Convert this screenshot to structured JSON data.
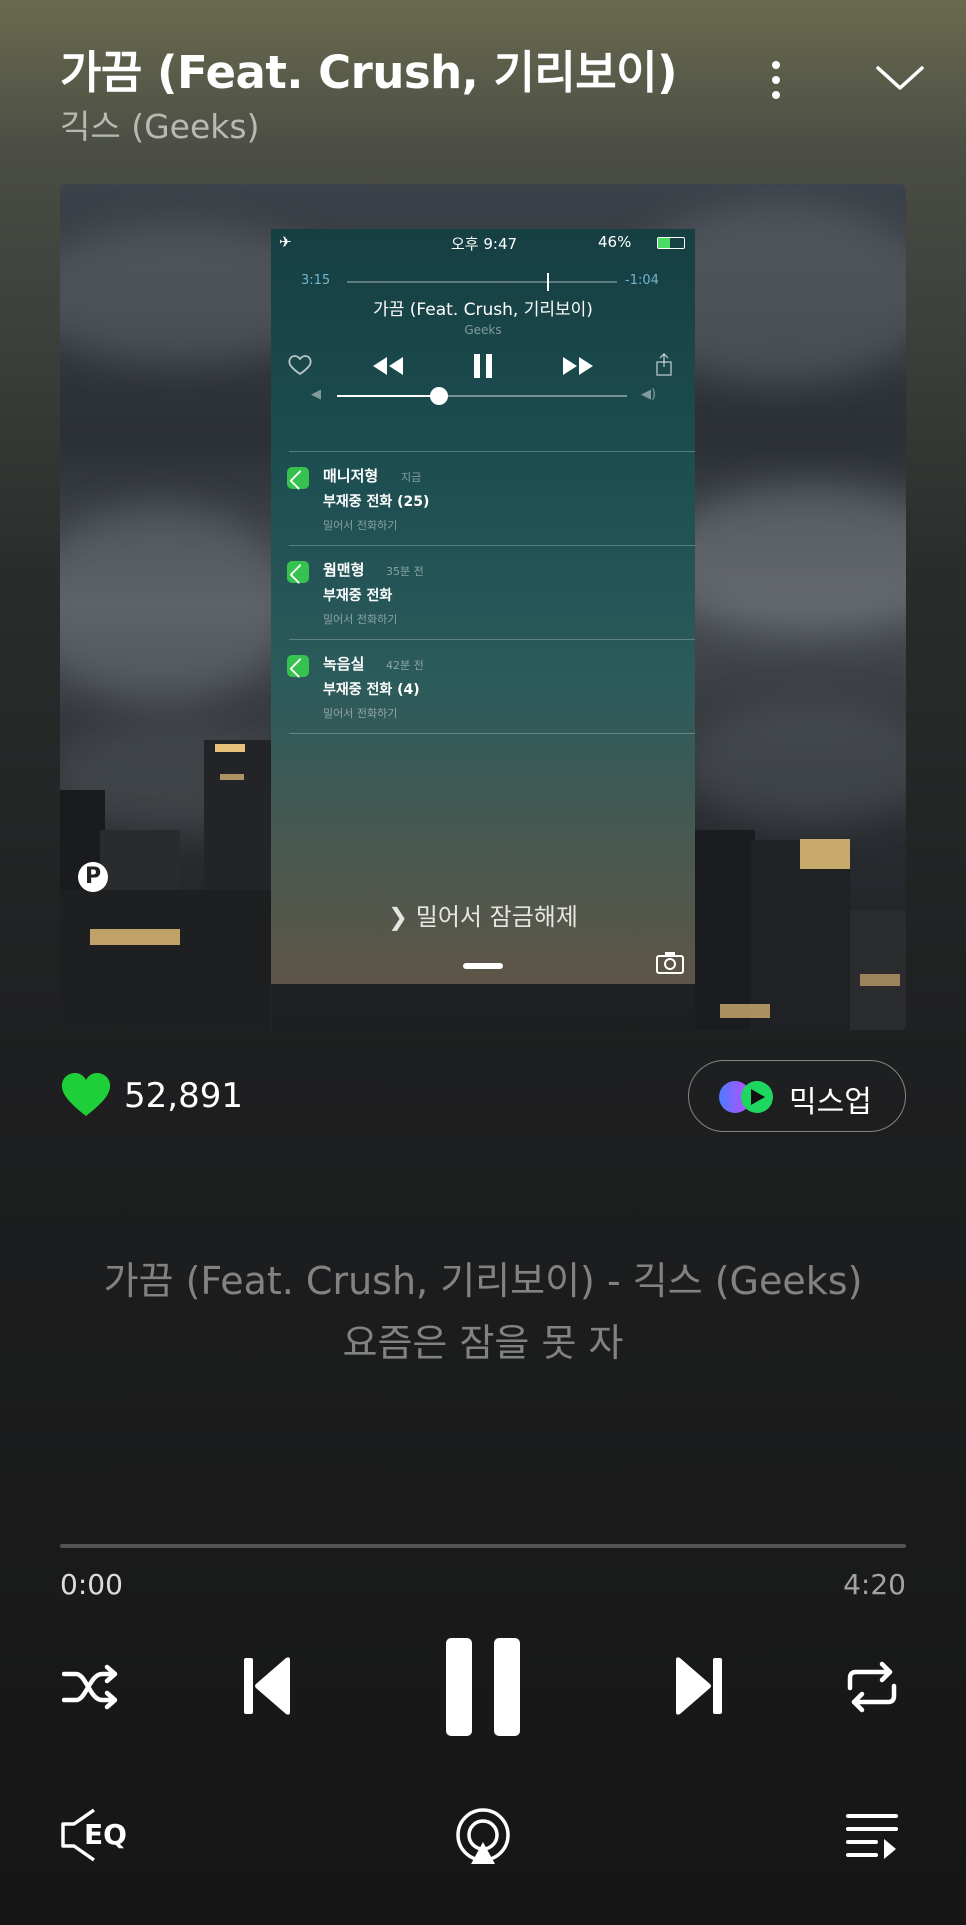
{
  "track": {
    "title": "가끔 (Feat. Crush, 기리보이)",
    "artist": "긱스 (Geeks)"
  },
  "album_art": {
    "phone_time": "오후 9:47",
    "phone_battery": "46%",
    "elapsed": "3:15",
    "remaining": "-1:04",
    "song": "가끔 (Feat. Crush, 기리보이)",
    "song_artist": "Geeks",
    "notifications": [
      {
        "from": "매니저형",
        "when": "지금",
        "title": "부재중 전화 (25)",
        "action": "밀어서 전화하기"
      },
      {
        "from": "웜맨형",
        "when": "35분 전",
        "title": "부재중 전화",
        "action": "밀어서 전화하기"
      },
      {
        "from": "녹음실",
        "when": "42분 전",
        "title": "부재중 전화 (4)",
        "action": "밀어서 전화하기"
      }
    ],
    "unlock_text": "밀어서 잠금해제",
    "volume_level": 0.35
  },
  "likes": {
    "count": "52,891"
  },
  "mixup": {
    "label": "믹스업"
  },
  "lyrics": {
    "line1": "가끔 (Feat. Crush, 기리보이) - 긱스 (Geeks)",
    "line2": "요즘은 잠을 못 자"
  },
  "playback": {
    "current_time": "0:00",
    "total_time": "4:20",
    "progress": 0.0
  },
  "colors": {
    "accent_green": "#1ed760",
    "heart": "#1fcf3a"
  },
  "icons": [
    "more-icon",
    "chevron-down-icon",
    "heart-icon",
    "mixup-icon",
    "shuffle-icon",
    "previous-icon",
    "pause-icon",
    "next-icon",
    "repeat-icon",
    "eq-icon",
    "airplay-icon",
    "playlist-icon"
  ],
  "bottom": {
    "eq_label": "EQ"
  }
}
